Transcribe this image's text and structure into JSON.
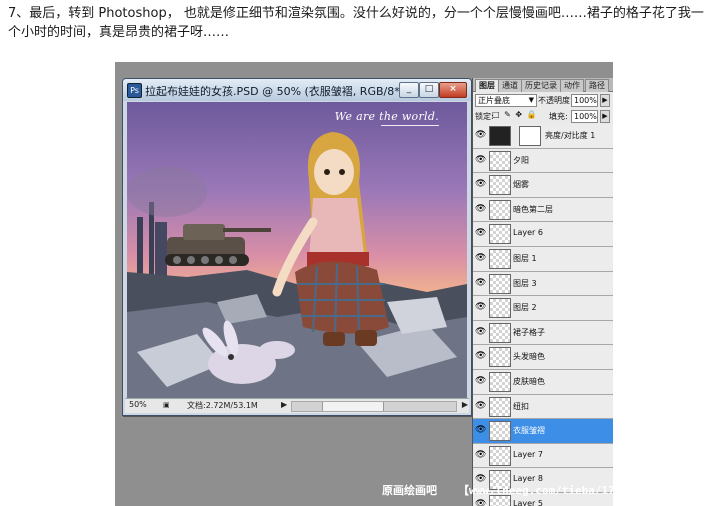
{
  "paragraph": "7、最后，转到 Photoshop， 也就是修正细节和渲染氛围。没什么好说的，分一个个层慢慢画吧……裙子的格子花了我一个小时的时间，真是昂贵的裙子呀……",
  "document_window": {
    "title": "拉起布娃娃的女孩.PSD @ 50% (衣服皱褶, RGB/8*)",
    "icon_label": "Ps",
    "minimize_label": "_",
    "maximize_label": "□",
    "close_label": "×",
    "canvas_caption": "We are the world."
  },
  "status_bar": {
    "zoom": "50%",
    "file_info": "文档:2.72M/53.1M",
    "arrow": "▶",
    "arrow_left": "◀"
  },
  "layers_panel": {
    "tabs": [
      "图层",
      "通道",
      "历史记录",
      "动作",
      "路径"
    ],
    "blend_mode": "正片叠底",
    "blend_arrow": "▼",
    "opacity_label": "不透明度:",
    "opacity_value": "100%",
    "lock_label": "锁定:",
    "lock_icons": "□ ✎ ✥ 🔒",
    "fill_label": "填充:",
    "fill_value": "100%",
    "stepper_arrow": "▶",
    "eye_glyph": "👁",
    "layers": [
      {
        "name": "亮度/对比度 1",
        "type": "adjustment",
        "selected": false
      },
      {
        "name": "夕阳",
        "type": "normal",
        "selected": false
      },
      {
        "name": "烟雾",
        "type": "normal",
        "selected": false
      },
      {
        "name": "暗色第二层",
        "type": "normal",
        "selected": false
      },
      {
        "name": "Layer 6",
        "type": "normal",
        "selected": false
      },
      {
        "name": "图层 1",
        "type": "normal",
        "selected": false
      },
      {
        "name": "图层 3",
        "type": "normal",
        "selected": false
      },
      {
        "name": "图层 2",
        "type": "normal",
        "selected": false
      },
      {
        "name": "裙子格子",
        "type": "normal",
        "selected": false
      },
      {
        "name": "头发暗色",
        "type": "normal",
        "selected": false
      },
      {
        "name": "皮肤暗色",
        "type": "normal",
        "selected": false
      },
      {
        "name": "纽扣",
        "type": "normal",
        "selected": false
      },
      {
        "name": "衣服皱褶",
        "type": "normal",
        "selected": true
      },
      {
        "name": "Layer 7",
        "type": "normal",
        "selected": false
      },
      {
        "name": "Layer 8",
        "type": "normal",
        "selected": false
      },
      {
        "name": "Layer 5",
        "type": "normal",
        "selected": false
      }
    ]
  },
  "watermark": {
    "left": "原画绘画吧",
    "right": "【www.lneeg.com/tieba/1797】"
  },
  "colors": {
    "selected_layer": "#3d8ee6",
    "workspace": "#8f8f8f",
    "panel_bg": "#eaeaea"
  }
}
